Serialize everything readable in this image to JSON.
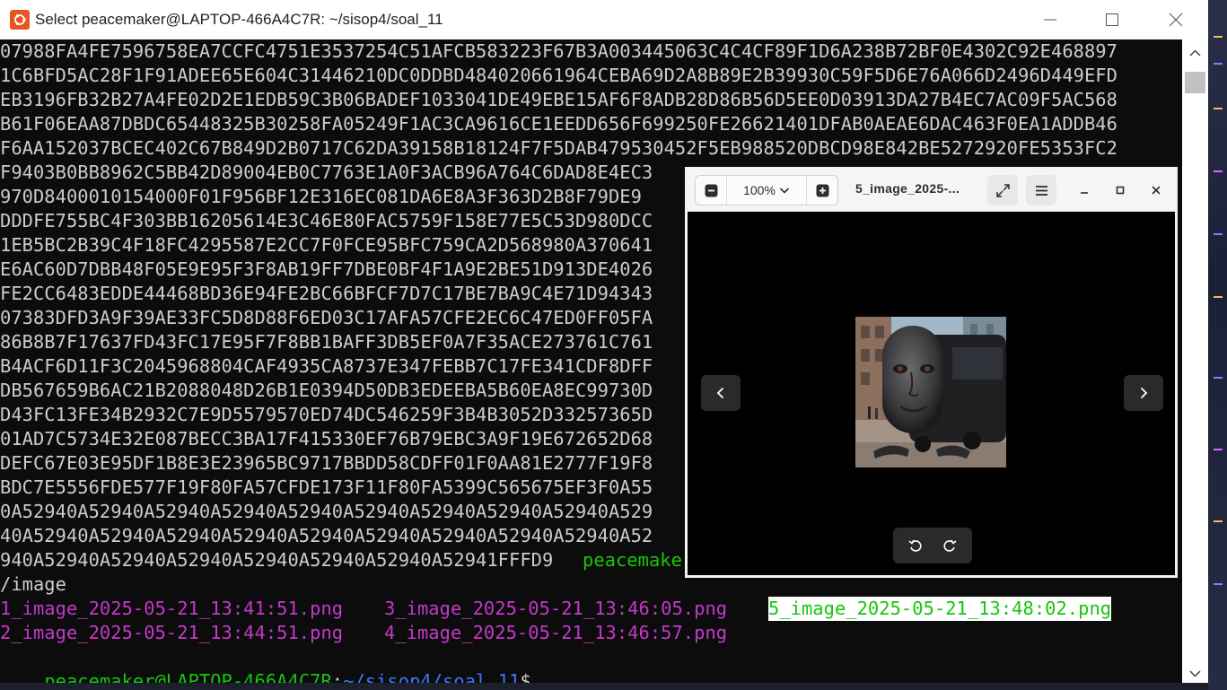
{
  "terminal": {
    "title": "Select peacemaker@LAPTOP-466A4C7R: ~/sisop4/soal_11",
    "hex_lines": [
      "07988FA4FE7596758EA7CCFC4751E3537254C51AFCB583223F67B3A003445063C4C4CF89F1D6A238B72BF0E4302C92E468897",
      "1C6BFD5AC28F1F91ADEE65E604C31446210DC0DDBD484020661964CEBA69D2A8B89E2B39930C59F5D6E76A066D2496D449EFD",
      "EB3196FB32B27A4FE02D2E1EDB59C3B06BADEF1033041DE49EBE15AF6F8ADB28D86B56D5EE0D03913DA27B4EC7AC09F5AC568",
      "B61F06EAA87DBDC65448325B30258FA05249F1AC3CA9616CE1EEDD656F699250FE26621401DFAB0AEAE6DAC463F0EA1ADDB46",
      "F6AA152037BCEC402C67B849D2B0717C62DA39158B18124F7F5DAB479530452F5EB988520DBCD98E842BE5272920FE5353FC2",
      "F9403B0BB8962C5BB42D89004EB0C7763E1A0F3ACB96A764C6DAD8E4EC3",
      "970D8400010154000F01F956BF12E316EC081DA6E8A3F363D2B8F79DE9",
      "DDDFE755BC4F303BB16205614E3C46E80FAC5759F158E77E5C53D980DCC",
      "1EB5BC2B39C4F18FC4295587E2CC7F0FCE95BFC759CA2D568980A370641",
      "E6AC60D7DBB48F05E9E95F3F8AB19FF7DBE0BF4F1A9E2BE51D913DE4026",
      "FE2CC6483EDDE44468BD36E94FE2BC66BFCF7D7C17BE7BA9C4E71D94343",
      "07383DFD3A9F39AE33FC5D8D88F6ED03C17AFA57CFE2EC6C47ED0FF05FA",
      "86B8B7F17637FD43FC17E95F7F8BB1BAFF3DB5EF0A7F35ACE273761C761",
      "B4ACF6D11F3C2045968804CAF4935CA8737E347FEBB7C17FE341CDF8DFF",
      "DB567659B6AC21B2088048D26B1E0394D50DB3EDEEBA5B60EA8EC99730D",
      "D43FC13FE34B2932C7E9D5579570ED74DC546259F3B4B3052D33257365D",
      "01AD7C5734E32E087BECC3BA17F415330EF76B79EBC3A9F19E672652D68",
      "DEFC67E03E95DF1B8E3E23965BC9717BBDD58CDFF01F0AA81E2777F19F8",
      "BDC7E5556FDE577F19F80FA57CFDE173F11F80FA5399C565675EF3F0A55",
      "0A52940A52940A52940A52940A52940A52940A52940A52940A52940A529",
      "40A52940A52940A52940A52940A52940A52940A52940A52940A52940A52",
      "940A52940A52940A52940A52940A52940A52940A52941FFFD9"
    ],
    "prompt_tail": "peacemake",
    "path_line": "/image",
    "files_row1": [
      "1_image_2025-05-21_13:41:51.png",
      "3_image_2025-05-21_13:46:05.png",
      "5_image_2025-05-21_13:48:02.png"
    ],
    "files_row2": [
      "2_image_2025-05-21_13:44:51.png",
      "4_image_2025-05-21_13:46:57.png"
    ],
    "prompt": {
      "user_host": "peacemaker@LAPTOP-466A4C7R",
      "separator": ":",
      "path": "~/sisop4/soal_11",
      "symbol": "$"
    }
  },
  "viewer": {
    "zoom": "100%",
    "title": "5_image_2025-...",
    "image_icon": "bus-with-face-image"
  },
  "colors": {
    "terminal_bg": "#0c0c0c",
    "terminal_fg": "#cccccc",
    "prompt_green": "#16c60c",
    "path_blue": "#3b78ff",
    "file_magenta": "#c239c8"
  }
}
